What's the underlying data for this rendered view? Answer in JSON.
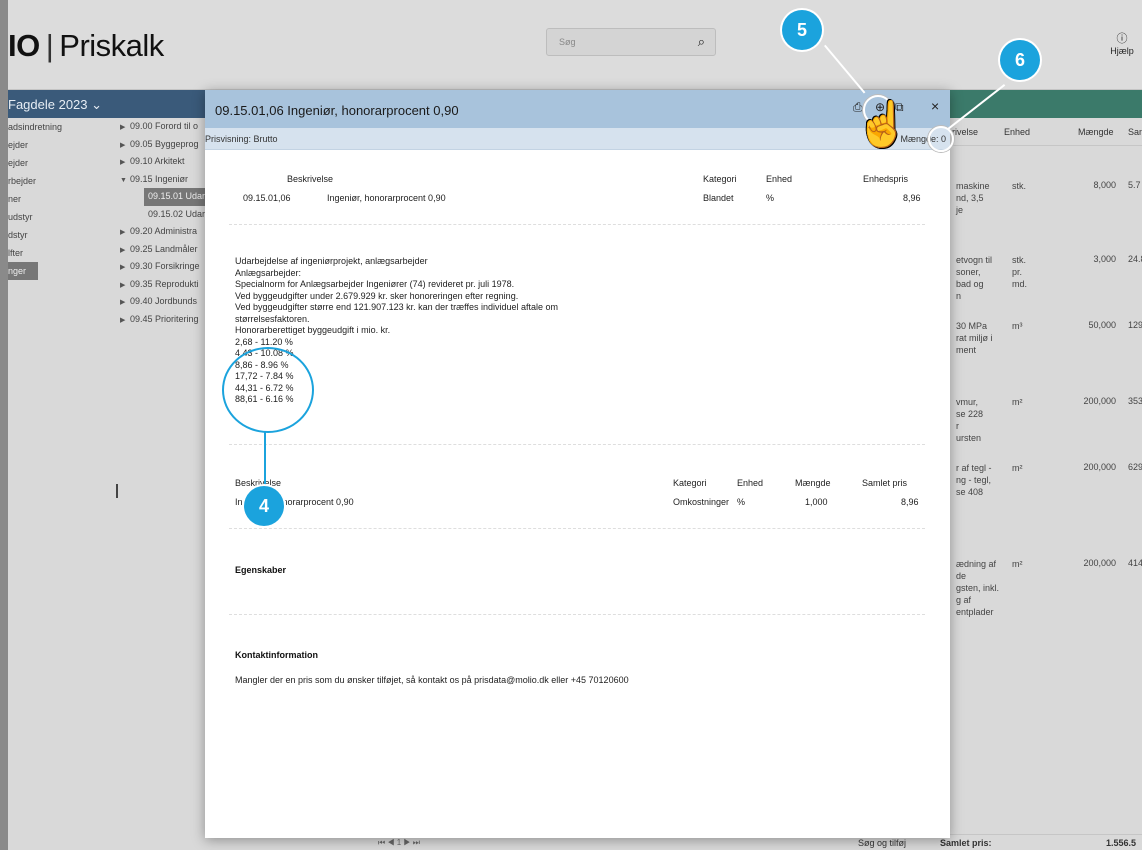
{
  "header": {
    "brand_left": "IO",
    "brand_sep": "|",
    "brand_right": "Priskalk",
    "search_placeholder": "Søg",
    "help_label": "Hjælp"
  },
  "nav": {
    "fagdele": "Fagdele 2023 ⌄"
  },
  "left_tree": [
    "adsindretning",
    "ejder",
    "ejder",
    "rbejder",
    "ner",
    "udstyr",
    "dstyr",
    "lfter",
    "nger"
  ],
  "mid_tree": [
    {
      "label": "09.00 Forord til o",
      "arrow": "▶"
    },
    {
      "label": "09.05 Byggeprog",
      "arrow": "▶"
    },
    {
      "label": "09.10 Arkitekt",
      "arrow": "▶"
    },
    {
      "label": "09.15 Ingeniør",
      "arrow": "▼"
    },
    {
      "label": "09.15.01 Udar",
      "sub": "sel"
    },
    {
      "label": "09.15.02 Udar",
      "sub": "plain"
    },
    {
      "label": "09.20 Administra",
      "arrow": "▶"
    },
    {
      "label": "09.25 Landmåler",
      "arrow": "▶"
    },
    {
      "label": "09.30 Forsikringe",
      "arrow": "▶"
    },
    {
      "label": "09.35 Reprodukti",
      "arrow": "▶"
    },
    {
      "label": "09.40 Jordbunds",
      "arrow": "▶"
    },
    {
      "label": "09.45 Prioritering",
      "arrow": "▶"
    }
  ],
  "right_table": {
    "headers": {
      "desc": "rivelse",
      "unit": "Enhed",
      "qty": "Mængde",
      "sum": "Saml"
    },
    "rows": [
      {
        "desc": [
          "maskine",
          "nd, 3,5",
          "je"
        ],
        "unit": [
          "stk."
        ],
        "qty": "8,000",
        "sum": "5.7"
      },
      {
        "desc": [
          "etvogn til",
          "soner,",
          "bad og",
          "n"
        ],
        "unit": [
          "stk.",
          "pr.",
          "md."
        ],
        "qty": "3,000",
        "sum": "24.8"
      },
      {
        "desc": [
          "30 MPa",
          "rat miljø i",
          "ment"
        ],
        "unit": [
          "m³"
        ],
        "qty": "50,000",
        "sum": "129.3"
      },
      {
        "desc": [
          "vmur,",
          "se 228",
          "r",
          "ursten"
        ],
        "unit": [
          "m²"
        ],
        "qty": "200,000",
        "sum": "353.0"
      },
      {
        "desc": [
          "r af tegl -",
          "ng - tegl,",
          "se 408"
        ],
        "unit": [
          "m²"
        ],
        "qty": "200,000",
        "sum": "629.0"
      },
      {
        "desc": [
          "ædning af",
          "de",
          "gsten, inkl.",
          "g af",
          "entplader"
        ],
        "unit": [
          "m²"
        ],
        "qty": "200,000",
        "sum": "414.3"
      }
    ],
    "footer": {
      "search": "Søg og tilføj",
      "total_label": "Samlet pris:",
      "total_value": "1.556.5"
    }
  },
  "pager": "⏮ ◀ 1 ▶ ⏭",
  "modal": {
    "title": "09.15.01,06  Ingeniør, honorarprocent 0,90",
    "icons": {
      "print": "⎙",
      "add": "⊕",
      "copy": "⧉",
      "close": "×"
    },
    "price_view": "Prisvisning: Brutto",
    "quantity": "Mængde: 0",
    "table1": {
      "headers": [
        "Beskrivelse",
        "Kategori",
        "Enhed",
        "Enhedspris"
      ],
      "row": [
        "09.15.01,06",
        "Ingeniør, honorarprocent 0,90",
        "Blandet",
        "%",
        "8,96"
      ]
    },
    "description": [
      "Udarbejdelse af ingeniørprojekt, anlægsarbejder",
      "Anlægsarbejder:",
      "Specialnorm for Anlægsarbejder Ingeniører (74) revideret pr. juli 1978.",
      "Ved byggeudgifter under 2.679.929 kr. sker honoreringen efter regning.",
      "Ved byggeudgifter større end 121.907.123 kr. kan der træffes individuel aftale om",
      "størrelsesfaktoren.",
      "Honorarberettiget byggeudgift i mio. kr.",
      "2,68 - 11.20 %",
      "4,43 - 10.08 %",
      "8,86 - 8.96 %",
      "17,72 - 7.84 %",
      "44,31 - 6.72 %",
      "88,61 - 6.16 %"
    ],
    "table2": {
      "headers": [
        "Beskrivelse",
        "Kategori",
        "Enhed",
        "Mængde",
        "Samlet pris"
      ],
      "row": [
        "Ingeniør, honorarprocent 0,90",
        "Omkostninger",
        "%",
        "1,000",
        "8,96"
      ]
    },
    "properties_title": "Egenskaber",
    "contact_title": "Kontaktinformation",
    "contact_text": "Mangler der en pris som du ønsker tilføjet, så kontakt os på prisdata@molio.dk eller +45 70120600"
  },
  "annotations": {
    "badge4": "4",
    "badge5": "5",
    "badge6": "6",
    "accent": "#1ba3dd"
  }
}
